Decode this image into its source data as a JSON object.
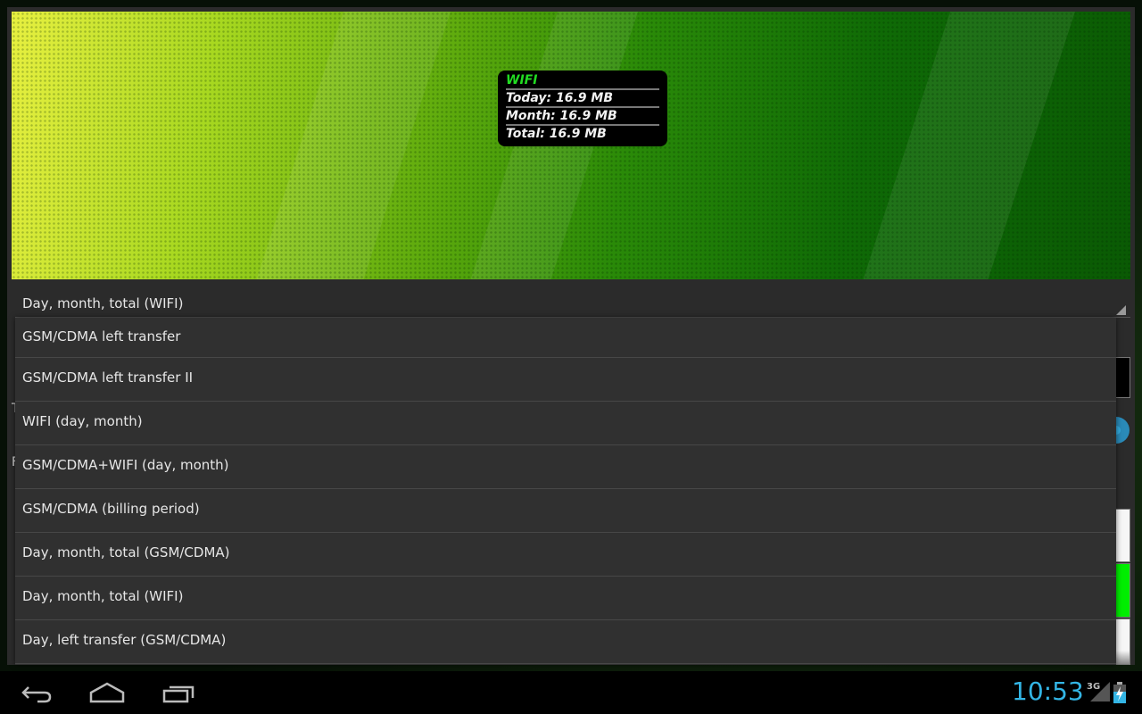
{
  "widget": {
    "title": "WIFI",
    "today": "Today: 16.9 MB",
    "month": "Month: 16.9 MB",
    "total": "Total: 16.9 MB"
  },
  "spinner": {
    "selected": "Day, month, total (WIFI)"
  },
  "background_labels": {
    "t": "T",
    "r": "F"
  },
  "dropdown": {
    "items": [
      {
        "label": "GSM/CDMA left transfer"
      },
      {
        "label": "GSM/CDMA left transfer II"
      },
      {
        "label": "WIFI (day, month)"
      },
      {
        "label": "GSM/CDMA+WIFI (day, month)"
      },
      {
        "label": "GSM/CDMA (billing period)"
      },
      {
        "label": "Day, month, total (GSM/CDMA)"
      },
      {
        "label": "Day, month, total (WIFI)"
      },
      {
        "label": "Day, left transfer (GSM/CDMA)"
      }
    ]
  },
  "status": {
    "time": "10:53",
    "network": "3G",
    "accent": "#33b5e5"
  },
  "colors": {
    "widget_title": "#22dd22",
    "progress_green": "#00ee00"
  }
}
